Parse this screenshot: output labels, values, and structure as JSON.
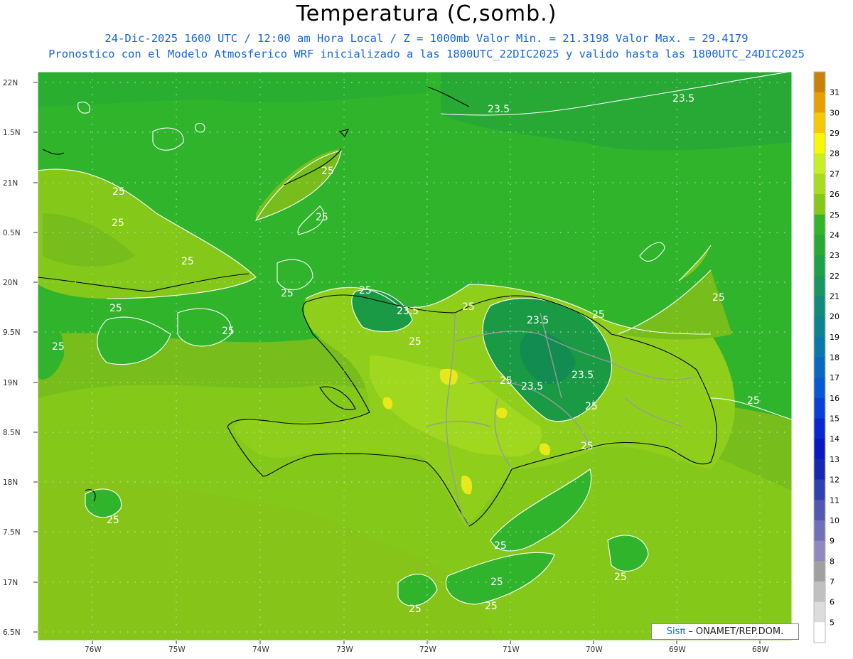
{
  "header": {
    "title": "Temperatura (C,somb.)",
    "line1": "24-Dic-2025 1600 UTC / 12:00 am Hora Local / Z = 1000mb  Valor Min. = 21.3198  Valor Max. = 29.4179",
    "line2": "Pronostico con el Modelo Atmosferico WRF inicializado a las 1800UTC_22DIC2025 y valido hasta las  1800UTC_24DIC2025"
  },
  "axes": {
    "lat_labels": [
      "22N",
      "1.5N",
      "21N",
      "0.5N",
      "20N",
      "9.5N",
      "19N",
      "8.5N",
      "18N",
      "7.5N",
      "17N",
      "6.5N"
    ],
    "lon_labels": [
      "76W",
      "75W",
      "74W",
      "73W",
      "72W",
      "71W",
      "70W",
      "69W",
      "68W"
    ]
  },
  "colorbar": {
    "labels": [
      "31",
      "30",
      "29",
      "28",
      "27",
      "26",
      "25",
      "24",
      "23",
      "22",
      "21",
      "20",
      "19",
      "18",
      "17",
      "16",
      "15",
      "14",
      "13",
      "12",
      "11",
      "10",
      "9",
      "8",
      "7",
      "6",
      "5"
    ],
    "colors": [
      "#c8820a",
      "#e8a000",
      "#f8c800",
      "#f8f800",
      "#c8f020",
      "#a8dc1e",
      "#84c81a",
      "#34b428",
      "#28a834",
      "#20a048",
      "#189860",
      "#108c78",
      "#0c8490",
      "#0a78a8",
      "#0a68c0",
      "#0a58d0",
      "#0a40d8",
      "#0a28d0",
      "#0a18c0",
      "#1428b0",
      "#3040b0",
      "#5058b0",
      "#7070b8",
      "#9088c0",
      "#a0a0a0",
      "#c0c0c0",
      "#dcdcdc",
      "#ffffff"
    ]
  },
  "contour_labels": [
    "23.5",
    "23.5",
    "25",
    "25",
    "25",
    "25",
    "25",
    "25",
    "25",
    "25",
    "25",
    "25",
    "23.5",
    "25",
    "25",
    "25",
    "23.5",
    "25",
    "25",
    "23.5",
    "23.5",
    "25",
    "25",
    "25",
    "25",
    "25",
    "25",
    "25",
    "25",
    "25"
  ],
  "credit": {
    "logo": "Sisπ",
    "text": "– ONAMET/REP.DOM."
  },
  "colors": {
    "sea_warm": "#2fb42c",
    "land_mid": "#88c81c",
    "land_warm": "#9fd81e",
    "cool": "#1a9a44",
    "hot": "#e8e81a",
    "title_blue": "#1565e8"
  }
}
